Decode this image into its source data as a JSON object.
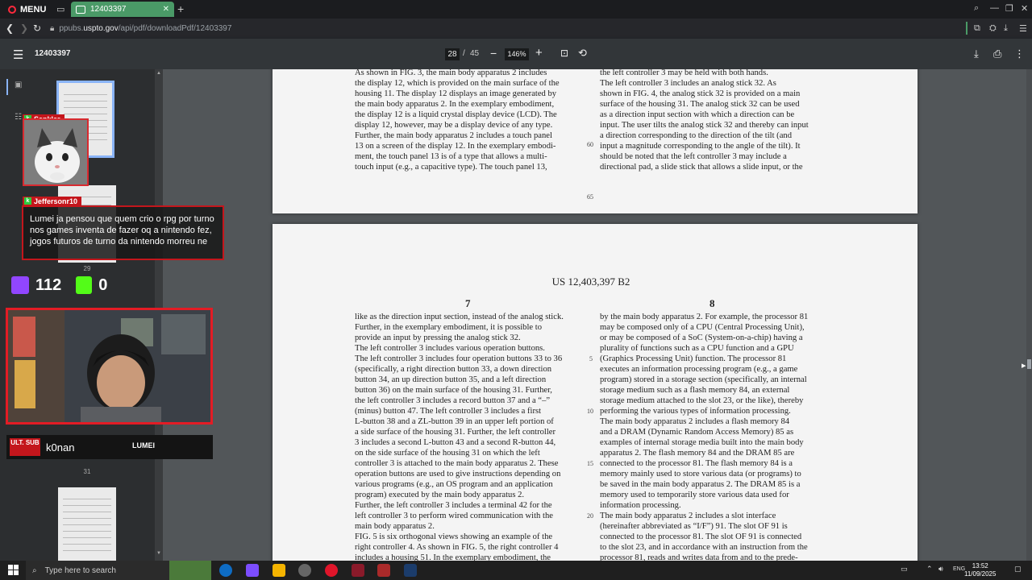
{
  "browser": {
    "menu_label": "MENU",
    "tab_title": "12403397",
    "url_prefix": "ppubs.",
    "url_host": "uspto.gov",
    "url_path": "/api/pdf/downloadPdf/12403397"
  },
  "pdf_toolbar": {
    "title": "12403397",
    "current_page": "28",
    "page_separator": "/",
    "total_pages": "45",
    "zoom": "146%"
  },
  "sidebar": {
    "thumb_numbers": [
      "29",
      "31"
    ]
  },
  "overlay": {
    "chat_user_1": "Sankler",
    "chat_user_2": "Jeffersonr10",
    "chat_message": "Lumei ja pensou que quem crio o rpg por turno nos games inventa de fazer oq a nintendo fez, jogos futuros de turno da nintendo morreu ne",
    "twitch_count": "112",
    "kick_count": "0",
    "sub_logo": "ULT. SUB",
    "streamer_name": "k0nan",
    "brand": "LUMEI"
  },
  "page_top": {
    "left_lines": [
      "As shown in FIG. 3, the main body apparatus 2 includes",
      "the display 12, which is provided on the main surface of the",
      "housing 11. The display 12 displays an image generated by",
      "the main body apparatus 2. In the exemplary embodiment,",
      "the display 12 is a liquid crystal display device (LCD). The",
      "display 12, however, may be a display device of any type.",
      "Further, the main body apparatus 2 includes a touch panel",
      "13 on a screen of the display 12. In the exemplary embodi-",
      "ment, the touch panel 13 is of a type that allows a multi-",
      "touch input (e.g., a capacitive type). The touch panel 13,"
    ],
    "right_lines": [
      "the left controller 3 may be held with both hands.",
      "The left controller 3 includes an analog stick 32. As",
      "shown in FIG. 4, the analog stick 32 is provided on a main",
      "surface of the housing 31. The analog stick 32 can be used",
      "as a direction input section with which a direction can be",
      "input. The user tilts the analog stick 32 and thereby can input",
      "a direction corresponding to the direction of the tilt (and",
      "input a magnitude corresponding to the angle of the tilt). It",
      "should be noted that the left controller 3 may include a",
      "directional pad, a slide stick that allows a slide input, or the"
    ],
    "line_numbers": [
      "60",
      "65"
    ]
  },
  "page_main": {
    "patent_number": "US 12,403,397 B2",
    "col_left_num": "7",
    "col_right_num": "8",
    "left_lines": [
      "like as the direction input section, instead of the analog stick.",
      "Further, in the exemplary embodiment, it is possible to",
      "provide an input by pressing the analog stick 32.",
      "The left controller 3 includes various operation buttons.",
      "The left controller 3 includes four operation buttons 33 to 36",
      "(specifically, a right direction button 33, a down direction",
      "button 34, an up direction button 35, and a left direction",
      "button 36) on the main surface of the housing 31. Further,",
      "the left controller 3 includes a record button 37 and a “–”",
      "(minus) button 47. The left controller 3 includes a first",
      "L-button 38 and a ZL-button 39 in an upper left portion of",
      "a side surface of the housing 31. Further, the left controller",
      "3 includes a second L-button 43 and a second R-button 44,",
      "on the side surface of the housing 31 on which the left",
      "controller 3 is attached to the main body apparatus 2. These",
      "operation buttons are used to give instructions depending on",
      "various programs (e.g., an OS program and an application",
      "program) executed by the main body apparatus 2.",
      "Further, the left controller 3 includes a terminal 42 for the",
      "left controller 3 to perform wired communication with the",
      "main body apparatus 2.",
      "FIG. 5 is six orthogonal views showing an example of the",
      "right controller 4. As shown in FIG. 5, the right controller 4",
      "includes a housing 51. In the exemplary embodiment, the"
    ],
    "right_lines": [
      "by the main body apparatus 2. For example, the processor 81",
      "may be composed only of a CPU (Central Processing Unit),",
      "or may be composed of a SoC (System-on-a-chip) having a",
      "plurality of functions such as a CPU function and a GPU",
      "(Graphics Processing Unit) function. The processor 81",
      "executes an information processing program (e.g., a game",
      "program) stored in a storage section (specifically, an internal",
      "storage medium such as a flash memory 84, an external",
      "storage medium attached to the slot 23, or the like), thereby",
      "performing the various types of information processing.",
      "The main body apparatus 2 includes a flash memory 84",
      "and a DRAM (Dynamic Random Access Memory) 85 as",
      "examples of internal storage media built into the main body",
      "apparatus 2. The flash memory 84 and the DRAM 85 are",
      "connected to the processor 81. The flash memory 84 is a",
      "memory mainly used to store various data (or programs) to",
      "be saved in the main body apparatus 2. The DRAM 85 is a",
      "memory used to temporarily store various data used for",
      "information processing.",
      "The main body apparatus 2 includes a slot interface",
      "(hereinafter abbreviated as “I/F”) 91. The slot OF 91 is",
      "connected to the processor 81. The slot OF 91 is connected",
      "to the slot 23, and in accordance with an instruction from the",
      "processor 81, reads and writes data from and to the prede-"
    ],
    "line_numbers": [
      "5",
      "10",
      "15",
      "20"
    ]
  },
  "taskbar": {
    "search_placeholder": "Type here to search",
    "lang": "ENG",
    "time": "13:52",
    "date": "11/09/2025"
  }
}
